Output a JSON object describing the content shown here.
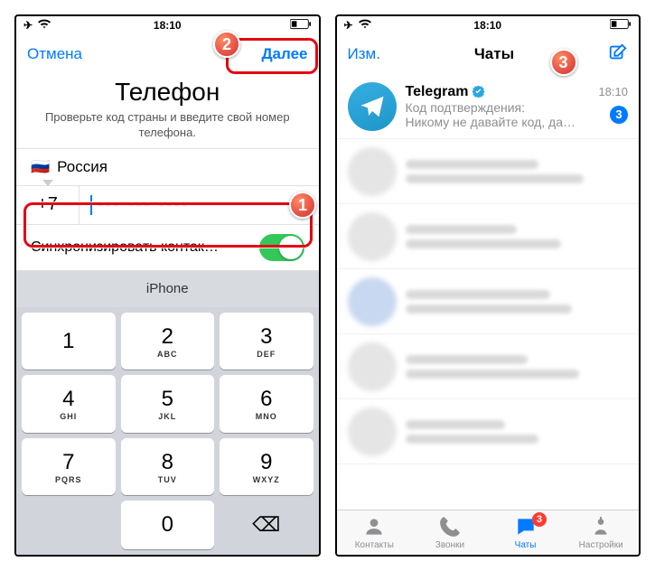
{
  "status": {
    "time": "18:10"
  },
  "screen1": {
    "nav": {
      "cancel": "Отмена",
      "next": "Далее"
    },
    "title": "Телефон",
    "subtitle": "Проверьте код страны и введите свой номер телефона.",
    "country": {
      "flag": "🇷🇺",
      "name": "Россия"
    },
    "dial_code": "+7",
    "phone_placeholder": "--- --- ----",
    "sync_label": "Синхронизировать контак…",
    "kbd_suggestion": "iPhone",
    "keys": [
      {
        "d": "1",
        "s": ""
      },
      {
        "d": "2",
        "s": "ABC"
      },
      {
        "d": "3",
        "s": "DEF"
      },
      {
        "d": "4",
        "s": "GHI"
      },
      {
        "d": "5",
        "s": "JKL"
      },
      {
        "d": "6",
        "s": "MNO"
      },
      {
        "d": "7",
        "s": "PQRS"
      },
      {
        "d": "8",
        "s": "TUV"
      },
      {
        "d": "9",
        "s": "WXYZ"
      },
      {
        "d": "",
        "s": ""
      },
      {
        "d": "0",
        "s": ""
      },
      {
        "d": "⌫",
        "s": ""
      }
    ]
  },
  "screen2": {
    "nav": {
      "edit": "Изм.",
      "title": "Чаты"
    },
    "chat0": {
      "name": "Telegram",
      "time": "18:10",
      "line1": "Код подтверждения:",
      "line2": "Никому не давайте код, да…",
      "unread": "3"
    },
    "tabs": {
      "contacts": "Контакты",
      "calls": "Звонки",
      "chats": "Чаты",
      "settings": "Настройки",
      "chats_badge": "3"
    }
  },
  "annotations": {
    "b1": "1",
    "b2": "2",
    "b3": "3"
  }
}
